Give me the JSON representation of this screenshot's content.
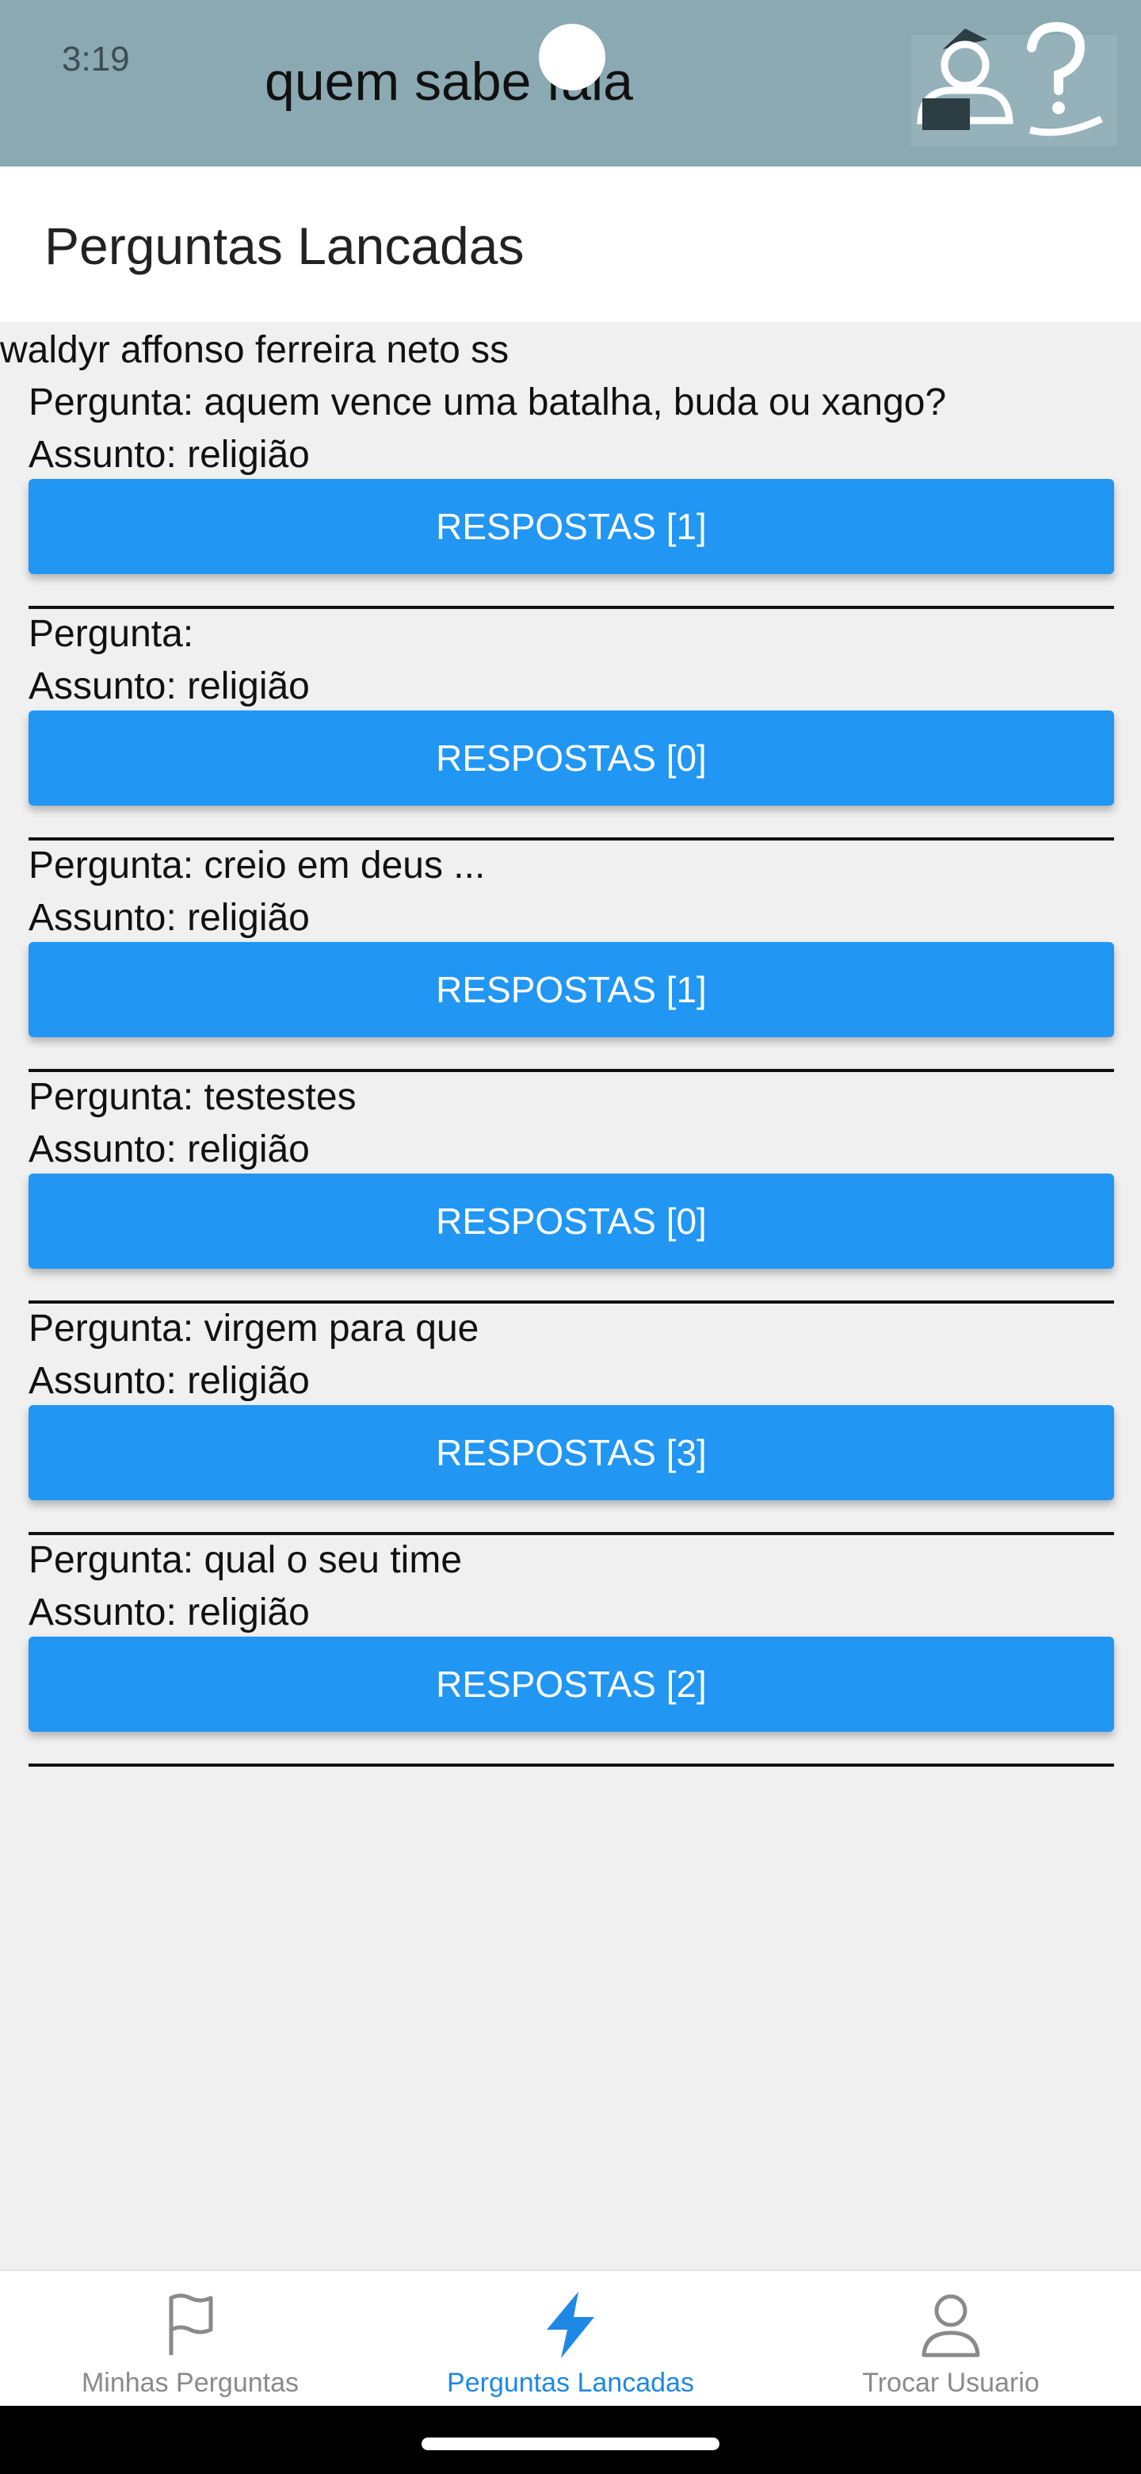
{
  "status_bar": {
    "time": "3:19"
  },
  "app_bar": {
    "title": "quem sabe fala"
  },
  "page": {
    "title": "Perguntas Lancadas"
  },
  "user": {
    "name": "waldyr affonso ferreira neto ss"
  },
  "questions": [
    {
      "pergunta": "Pergunta: aquem vence uma batalha, buda ou xango?",
      "assunto": "Assunto: religião",
      "button": "RESPOSTAS [1]"
    },
    {
      "pergunta": "Pergunta:",
      "assunto": "Assunto: religião",
      "button": "RESPOSTAS [0]"
    },
    {
      "pergunta": "Pergunta: creio em deus ...",
      "assunto": "Assunto: religião",
      "button": "RESPOSTAS [1]"
    },
    {
      "pergunta": "Pergunta: testestes",
      "assunto": "Assunto: religião",
      "button": "RESPOSTAS [0]"
    },
    {
      "pergunta": "Pergunta: virgem para que",
      "assunto": "Assunto: religião",
      "button": "RESPOSTAS [3]"
    },
    {
      "pergunta": "Pergunta: qual o seu time",
      "assunto": "Assunto: religião",
      "button": "RESPOSTAS [2]"
    }
  ],
  "bottom_nav": [
    {
      "label": "Minhas Perguntas",
      "icon": "flag-icon",
      "active": false
    },
    {
      "label": "Perguntas Lancadas",
      "icon": "bolt-icon",
      "active": true
    },
    {
      "label": "Trocar Usuario",
      "icon": "user-icon",
      "active": false
    }
  ],
  "colors": {
    "app_bar": "#8ba9b2",
    "button": "#2196f3",
    "active_nav": "#1e88e5",
    "inactive_nav": "#8a8a8a"
  }
}
